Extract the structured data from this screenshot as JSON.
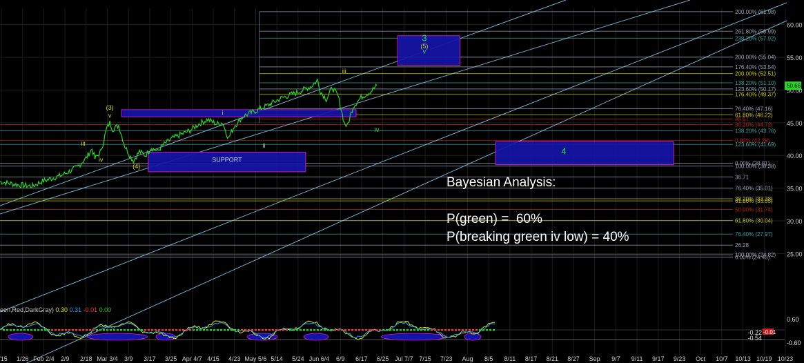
{
  "annotation": {
    "title": "Bayesian Analysis:",
    "line1": "P(green) =  60%",
    "line2": "P(breaking green iv low) = 40%"
  },
  "indicator": {
    "label": "een,Red,DarkGray)",
    "values": [
      {
        "text": "0.30",
        "color": "#e6e600"
      },
      {
        "text": "0.31",
        "color": "#1aa7ff"
      },
      {
        "text": "-0.01",
        "color": "#ff3030"
      },
      {
        "text": "0.00",
        "color": "#22cc22"
      }
    ],
    "scale": [
      "0.60",
      "-0.60"
    ],
    "readouts": [
      "-0.22",
      "-0.54"
    ],
    "last_box": "-0.01"
  },
  "colors": {
    "background": "#000000",
    "price": "#27d827",
    "channel": "#8fd8ff",
    "box_fill": "#1414a8",
    "box_border": "#d81cd8",
    "fib_yellow": "#c8c800",
    "fib_red": "#c02020",
    "fib_gray": "#9aa3b4",
    "fib_teal": "#3aa0a0",
    "wave_label": "#d8d800",
    "wave_label_green": "#2ee02e"
  },
  "chart_data": {
    "type": "line",
    "ylim": [
      20.5,
      62.5
    ],
    "y_ticks": [
      25,
      30,
      35,
      40,
      45,
      50,
      55,
      60
    ],
    "y_tick_labels": [
      "25.00",
      "30.00",
      "35.00",
      "40.00",
      "45.00",
      "50.00",
      "55.00",
      "60.00"
    ],
    "last_price": "50.66",
    "x_labels": [
      "1/15",
      "1/26",
      "Feb 2/4",
      "2/9",
      "2/18",
      "Mar 3/4",
      "3/9",
      "3/17",
      "3/25",
      "Apr 4/7",
      "4/15",
      "4/23",
      "May 5/6",
      "5/14",
      "5/24",
      "Jun 6/4",
      "6/9",
      "6/17",
      "6/25",
      "Jul 7/7",
      "7/15",
      "7/23",
      "Aug",
      "8/5",
      "8/11",
      "8/17",
      "8/21",
      "8/27",
      "Sep",
      "9/7",
      "9/11",
      "9/17",
      "9/23",
      "Oct",
      "10/7",
      "10/13",
      "10/19",
      "10/23"
    ],
    "price_series": [
      {
        "t": 0,
        "v": 36.0
      },
      {
        "t": 6,
        "v": 35.5
      },
      {
        "t": 11,
        "v": 35.3
      },
      {
        "t": 14,
        "v": 36.0
      },
      {
        "t": 21,
        "v": 37.0
      },
      {
        "t": 26,
        "v": 38.2
      },
      {
        "t": 29,
        "v": 39.6
      },
      {
        "t": 31,
        "v": 41.0
      },
      {
        "t": 32,
        "v": 39.5
      },
      {
        "t": 34,
        "v": 40.6
      },
      {
        "t": 36,
        "v": 44.2
      },
      {
        "t": 37,
        "v": 45.0
      },
      {
        "t": 38,
        "v": 44.0
      },
      {
        "t": 40,
        "v": 44.6
      },
      {
        "t": 42,
        "v": 41.5
      },
      {
        "t": 44,
        "v": 39.8
      },
      {
        "t": 45,
        "v": 39.2
      },
      {
        "t": 47,
        "v": 40.6
      },
      {
        "t": 49,
        "v": 40.0
      },
      {
        "t": 51,
        "v": 41.2
      },
      {
        "t": 53,
        "v": 40.6
      },
      {
        "t": 55,
        "v": 41.6
      },
      {
        "t": 58,
        "v": 42.6
      },
      {
        "t": 61,
        "v": 43.2
      },
      {
        "t": 64,
        "v": 43.8
      },
      {
        "t": 67,
        "v": 44.8
      },
      {
        "t": 70,
        "v": 45.5
      },
      {
        "t": 73,
        "v": 44.8
      },
      {
        "t": 75,
        "v": 45.0
      },
      {
        "t": 77,
        "v": 42.6
      },
      {
        "t": 79,
        "v": 44.5
      },
      {
        "t": 82,
        "v": 46.0
      },
      {
        "t": 86,
        "v": 46.8
      },
      {
        "t": 90,
        "v": 47.6
      },
      {
        "t": 95,
        "v": 48.8
      },
      {
        "t": 100,
        "v": 49.6
      },
      {
        "t": 105,
        "v": 50.6
      },
      {
        "t": 107,
        "v": 51.5
      },
      {
        "t": 108,
        "v": 49.8
      },
      {
        "t": 110,
        "v": 48.6
      },
      {
        "t": 112,
        "v": 50.4
      },
      {
        "t": 114,
        "v": 49.0
      },
      {
        "t": 116,
        "v": 45.0
      },
      {
        "t": 117,
        "v": 44.4
      },
      {
        "t": 119,
        "v": 47.5
      },
      {
        "t": 122,
        "v": 49.0
      },
      {
        "t": 125,
        "v": 49.8
      },
      {
        "t": 127,
        "v": 50.66
      }
    ],
    "fib_levels": [
      {
        "label": "200.00% (61.98)",
        "y": 61.98,
        "color": "#9aa3b4"
      },
      {
        "label": "261.80% (58.99)",
        "y": 58.99,
        "color": "#9aa3b4"
      },
      {
        "label": "238.20% (57.92)",
        "y": 57.92,
        "color": "#3aa0a0"
      },
      {
        "label": "200.00% (55.04)",
        "y": 55.04,
        "color": "#9aa3b4"
      },
      {
        "label": "176.40% (53.54)",
        "y": 53.54,
        "color": "#9aa3b4"
      },
      {
        "label": "200.00% (52.51)",
        "y": 52.51,
        "color": "#c8c800"
      },
      {
        "label": "138.20% (51.10)",
        "y": 51.1,
        "color": "#3aa0a0"
      },
      {
        "label": "123.60% (50.17)",
        "y": 50.17,
        "color": "#9aa3b4"
      },
      {
        "label": "176.40% (49.37)",
        "y": 49.37,
        "color": "#c8c800"
      },
      {
        "label": "76.40% (47.16)",
        "y": 47.16,
        "color": "#9aa3b4"
      },
      {
        "label": "61.80% (46.22)",
        "y": 46.22,
        "color": "#c8c800"
      },
      {
        "label": "45.57",
        "y": 45.57,
        "color": "#c02020"
      },
      {
        "label": "30.20% (44.72)",
        "y": 44.72,
        "color": "#c02020"
      },
      {
        "label": "138.20% (43.76)",
        "y": 43.76,
        "color": "#3aa0a0"
      },
      {
        "label": "0.00% (42.28)",
        "y": 42.28,
        "color": "#c02020"
      },
      {
        "label": "123.60% (41.69)",
        "y": 41.69,
        "color": "#3aa0a0"
      },
      {
        "label": "0.00% (38.81)",
        "y": 38.81,
        "color": "#9aa3b4"
      },
      {
        "label": "100.00% (38.38)",
        "y": 38.38,
        "color": "#9aa3b4"
      },
      {
        "label": "36.71",
        "y": 36.71,
        "color": "#9aa3b4"
      },
      {
        "label": "76.40% (35.01)",
        "y": 35.01,
        "color": "#9aa3b4"
      },
      {
        "label": "38.20% (33.38)",
        "y": 33.38,
        "color": "#c8c800"
      },
      {
        "label": "61.80% (33.05)",
        "y": 33.05,
        "color": "#c8c800"
      },
      {
        "label": "50.00% (31.74)",
        "y": 31.74,
        "color": "#c02020"
      },
      {
        "label": "61.80% (30.04)",
        "y": 30.04,
        "color": "#c8c800"
      },
      {
        "label": "76.40% (27.97)",
        "y": 27.97,
        "color": "#3aa0a0"
      },
      {
        "label": "26.28",
        "y": 26.28,
        "color": "#9aa3b4"
      },
      {
        "label": "100.00% (24.82)",
        "y": 24.82,
        "color": "#9aa3b4"
      },
      {
        "label": "0.00% (24.45)",
        "y": 24.45,
        "color": "#9aa3b4"
      }
    ],
    "wave_labels": [
      {
        "text": "iii",
        "t": 28,
        "v": 41.5,
        "color": "#d8d800"
      },
      {
        "text": "iv",
        "t": 34,
        "v": 39.0,
        "color": "#d8d800"
      },
      {
        "text": "(3)",
        "t": 37,
        "v": 47.0,
        "color": "#d8d800"
      },
      {
        "text": "v",
        "t": 37,
        "v": 45.8,
        "color": "#d8d800"
      },
      {
        "text": "(4)",
        "t": 46,
        "v": 38.0,
        "color": "#d8d800"
      },
      {
        "text": "i",
        "t": 75,
        "v": 46.2,
        "color": "#d8d800"
      },
      {
        "text": "ii",
        "t": 89,
        "v": 41.2,
        "color": "#d8d800"
      },
      {
        "text": "iii",
        "t": 116,
        "v": 52.6,
        "color": "#d8d800"
      },
      {
        "text": "iv",
        "t": 127,
        "v": 43.6,
        "color": "#2ee02e"
      },
      {
        "text": "3",
        "t": 143,
        "v": 57.5,
        "color": "#2ee02e"
      },
      {
        "text": "(5)",
        "t": 143,
        "v": 56.4,
        "color": "#d8d800"
      },
      {
        "text": "v",
        "t": 143,
        "v": 55.6,
        "color": "#2ee02e"
      },
      {
        "text": "4",
        "t": 190,
        "v": 40.2,
        "color": "#2ee02e"
      }
    ],
    "target_boxes": [
      {
        "name": "wave-3-box",
        "t1": 41,
        "t2": 120,
        "y1": 45.9,
        "y2": 47.0
      },
      {
        "name": "support-box",
        "t1": 50,
        "t2": 103,
        "y1": 37.5,
        "y2": 40.5,
        "label": "SUPPORT"
      },
      {
        "name": "wave-5-box",
        "t1": 134,
        "t2": 155,
        "y1": 53.8,
        "y2": 58.3
      },
      {
        "name": "wave-4-box",
        "t1": 167,
        "t2": 227,
        "y1": 38.6,
        "y2": 42.1
      }
    ]
  }
}
